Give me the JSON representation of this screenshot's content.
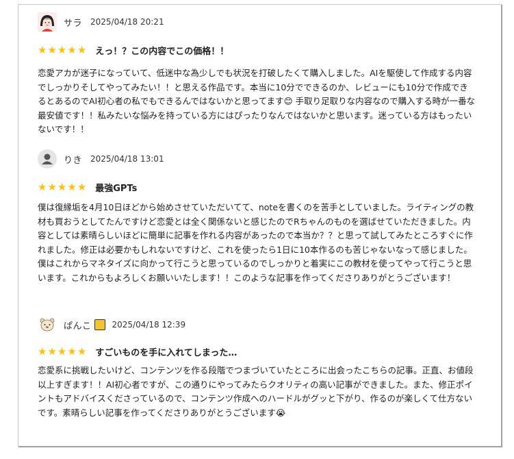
{
  "reviews": [
    {
      "user": "サラ",
      "date": "2025/04/18 20:21",
      "stars": 5,
      "title": "えっ！？この内容でこの価格！！",
      "avatar_icon": "girl-avatar-icon",
      "body": "恋愛アカが迷子になっていて、低迷中な為少しでも状況を打破したくて購入しました。AIを駆使して作成する内容でしっかりそしてやってみたい！！と思える作品です。本当に10分でできるのか、レビューにも10分で作成できるとあるのでAI初心者の私でもできるんではないかと思ってます😊 手取り足取りな内容なので購入する時が一番な最安値です！！私みたいな悩みを持っている方にはぴったりなんではないかと思います。迷っている方はもったいないです！！"
    },
    {
      "user": "りき",
      "date": "2025/04/18 13:01",
      "stars": 5,
      "title": "最強GPTs",
      "avatar_icon": "default-user-icon",
      "body": "僕は復縁垢を4月10日ほどから始めさせていただいてて、noteを書くのを苦手としていました。ライティングの教材も買おうとしてたんですけど恋愛とは全く関係ないと感じたのでRちゃんのものを選ばせていただきました。内容としては素晴らしいほどに簡単に記事を作れる内容があったので本当か？？と思って試してみたところすぐに作れました。修正は必要かもしれないですけど、これを使ったら1日に10本作るのも苦じゃないなって感じました。僕はこれからマネタイズに向かって行こうと思っているのでしっかりと着実にこの教材を使ってやって行こうと思います。これからもよろしくお願いいたします！！このような記事を作ってくださりありがとうございます！"
    },
    {
      "user": "ぱんこ",
      "date": "2025/04/18 12:39",
      "stars": 5,
      "title": "すごいものを手に入れてしまった…",
      "avatar_icon": "bear-avatar-icon",
      "badge_icon": "bread-badge-icon",
      "body": "恋愛系に挑戦したいけど、コンテンツを作る段階でつまづいていたところに出会ったこちらの記事。正直、お値段以上すぎます！！AI初心者ですが、この通りにやってみたらクオリティの高い記事ができました。また、修正ポイントもアドバイスくださっているので、コンテンツ作成へのハードルがグッと下がり、作るのが楽しくて仕方ないです。素晴らしい記事を作ってくださりありがとうございます😭"
    }
  ],
  "colors": {
    "star": "#ffc107",
    "text": "#222222",
    "border": "#c8c8c8"
  }
}
